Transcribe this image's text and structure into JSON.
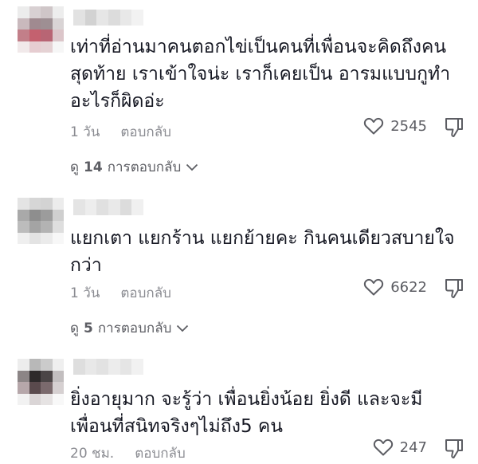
{
  "comments": [
    {
      "text_lines": [
        "เท่าที่อ่านมาคนตอกไข่เป็นคนที่เพื่อนจะคิดถึงคน",
        "สุดท้าย เราเข้าใจน่ะ เราก็เคยเป็น อารมแบบกูทำ",
        "อะไรก็ผิดอ่ะ"
      ],
      "time": "1 วัน",
      "reply_label": "ตอบกลับ",
      "likes": "2545",
      "view_replies": {
        "prefix": "ดู",
        "count": "14",
        "suffix": "การตอบกลับ"
      }
    },
    {
      "text_lines": [
        "แยกเตา แยกร้าน แยกย้ายคะ กินคนเดียวสบายใจ",
        "กว่า"
      ],
      "time": "1 วัน",
      "reply_label": "ตอบกลับ",
      "likes": "6622",
      "view_replies": {
        "prefix": "ดู",
        "count": "5",
        "suffix": "การตอบกลับ"
      }
    },
    {
      "text_lines": [
        "ยิ่งอายุมาก จะรู้ว่า เพื่อนยิ่งน้อย ยิ่งดี และจะมี",
        "เพื่อนที่สนิทจริงๆไม่ถึง5 คน"
      ],
      "time": "20 ชม.",
      "reply_label": "ตอบกลับ",
      "likes": "247"
    }
  ],
  "icons": {
    "like": "heart-outline-icon",
    "dislike": "thumbs-down-icon",
    "expand": "chevron-down-icon"
  },
  "colors": {
    "text": "#161823",
    "secondary": "#8a8b91"
  }
}
